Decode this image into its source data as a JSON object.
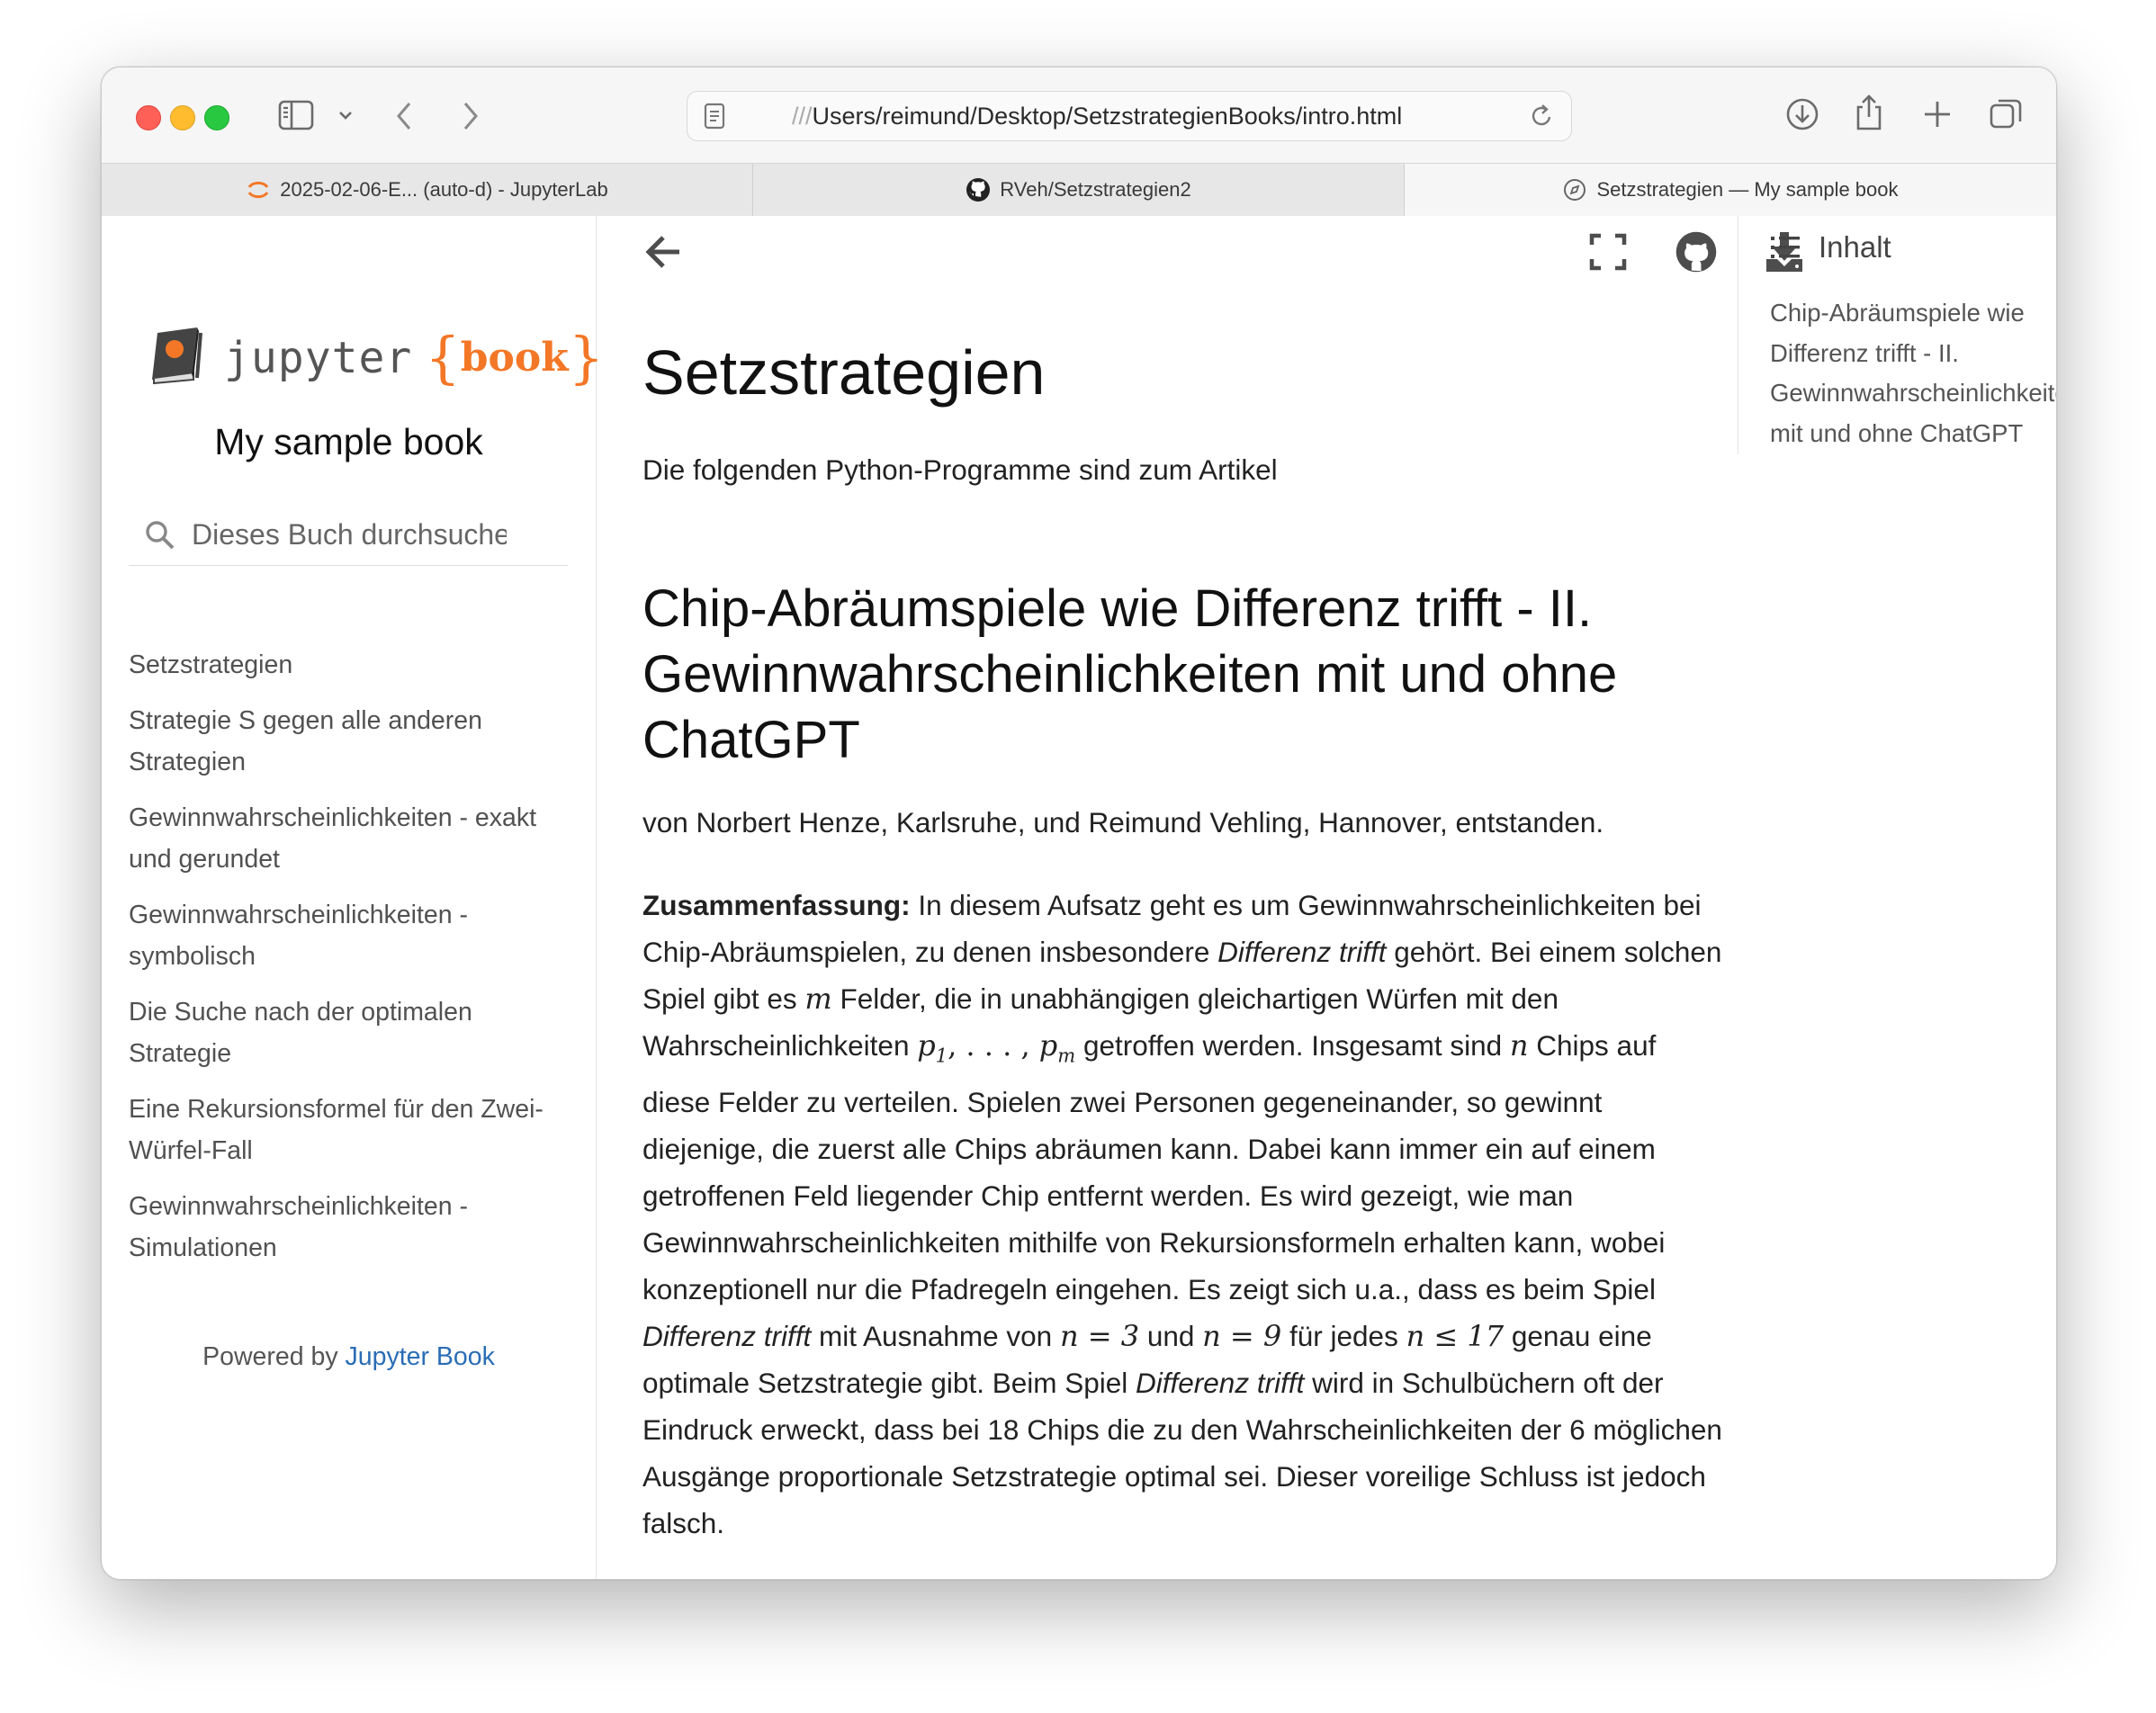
{
  "browser": {
    "url_prefix": "///",
    "url_path": "Users/reimund/Desktop/SetzstrategienBooks/intro.html",
    "tabs": [
      {
        "label": "2025-02-06-E... (auto-d) - JupyterLab",
        "icon": "jupyter-icon"
      },
      {
        "label": "RVeh/Setzstrategien2",
        "icon": "github-icon"
      },
      {
        "label": "Setzstrategien — My sample book",
        "icon": "compass-icon",
        "active": true
      }
    ]
  },
  "sidebar": {
    "logo_word": "jupyter",
    "logo_book": "book",
    "logo_brace_open": "{",
    "logo_brace_close": "}",
    "book_title": "My sample book",
    "search_placeholder": "Dieses Buch durchsuchen...",
    "nav": [
      "Setzstrategien",
      "Strategie S gegen alle anderen Strategien",
      "Gewinnwahrscheinlichkeiten - exakt und gerundet",
      "Gewinnwahrscheinlichkeiten - symbolisch",
      "Die Suche nach der optimalen Strategie",
      "Eine Rekursionsformel für den Zwei-Würfel-Fall",
      "Gewinnwahrscheinlichkeiten - Simulationen"
    ],
    "powered_prefix": "Powered by",
    "powered_link": "Jupyter Book"
  },
  "main": {
    "title": "Setzstrategien",
    "intro": "Die folgenden Python-Programme sind zum Artikel",
    "heading": "Chip-Abräumspiele wie Differenz trifft - II. Gewinnwahrscheinlichkeiten mit und ohne ChatGPT",
    "authors": "von Norbert Henze, Karlsruhe, und Reimund Vehling, Hannover, entstanden.",
    "abstract": {
      "label": "Zusammenfassung:",
      "t1": " In diesem Aufsatz geht es um Gewinnwahrscheinlichkeiten bei Chip-Abräumspielen, zu denen insbesondere ",
      "em1": "Differenz trifft",
      "t2": " gehört. Bei einem solchen Spiel gibt es ",
      "m_m": "m",
      "t3": " Felder, die in unabhängigen gleichartigen Würfen mit den Wahrscheinlichkeiten ",
      "m_p1": "p",
      "m_p1_sub": "1",
      "m_dots": ", . . . , ",
      "m_pm": "p",
      "m_pm_sub": "m",
      "t4": " getroffen werden. Insgesamt sind ",
      "m_n": "n",
      "t5": " Chips auf diese Felder zu verteilen. Spielen zwei Personen gegeneinander, so gewinnt diejenige, die zuerst alle Chips abräumen kann. Dabei kann immer ein auf einem getroffenen Feld liegender Chip entfernt werden. Es wird gezeigt, wie man Gewinnwahrscheinlichkeiten mithilfe von Rekursionsformeln erhalten kann, wobei konzeptionell nur die Pfadregeln eingehen. Es zeigt sich u.a., dass es beim Spiel ",
      "em2": "Differenz trifft",
      "t6": " mit Ausnahme von ",
      "m_n3": "n = 3",
      "t7": " und ",
      "m_n9": "n = 9",
      "t8": " für jedes ",
      "m_n17": "n ≤ 17",
      "t9": " genau eine optimale Setzstrategie gibt. Beim Spiel ",
      "em3": "Differenz trifft",
      "t10": " wird in Schulbüchern oft der Eindruck erweckt, dass bei 18 Chips die zu den Wahrscheinlichkeiten der 6 möglichen Ausgänge proportionale Setzstrategie optimal sei. Dieser voreilige Schluss ist jedoch falsch."
    }
  },
  "toc": {
    "label": "Inhalt",
    "items": [
      "Chip-Abräumspiele wie Differenz trifft - II. Gewinnwahrscheinlichkeiten mit und ohne ChatGPT"
    ]
  },
  "colors": {
    "accent": "#f37726",
    "link": "#2a6db5"
  }
}
